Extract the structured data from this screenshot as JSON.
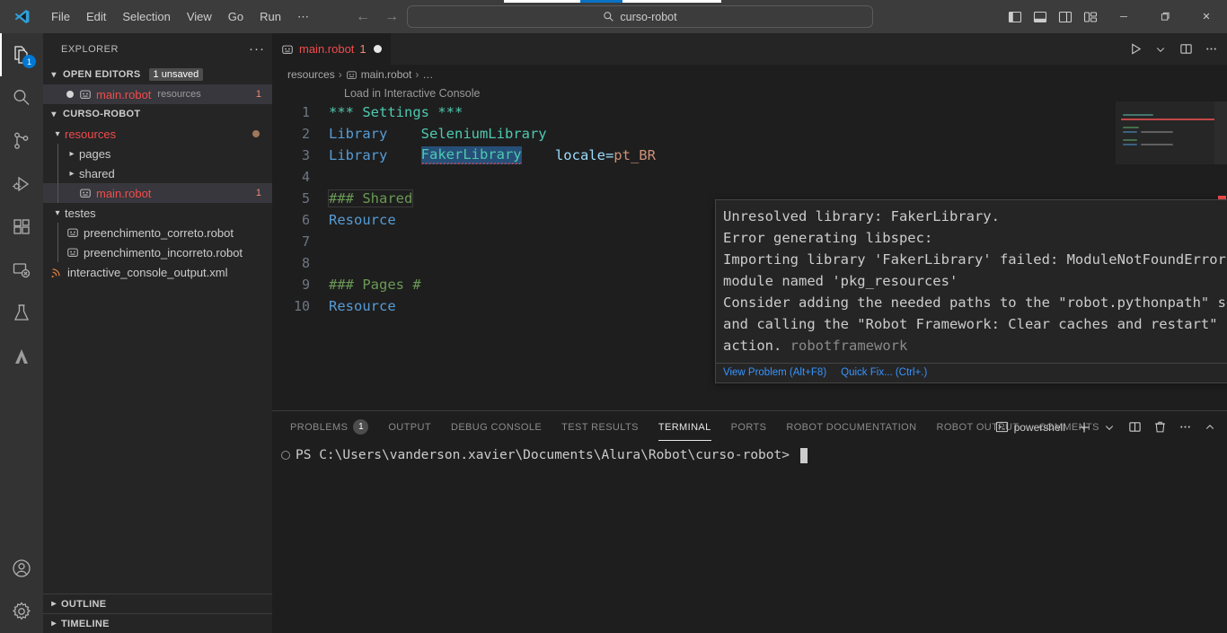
{
  "window": {
    "title": "main.robot",
    "menu": [
      "File",
      "Edit",
      "Selection",
      "View",
      "Go",
      "Run",
      "⋯"
    ],
    "search_value": "curso-robot",
    "nav_back": "←",
    "nav_forward": "→",
    "minimize": "─",
    "maximize": "❐",
    "close": "✕"
  },
  "activitybar": {
    "items": [
      {
        "name": "explorer",
        "badge": "1"
      },
      {
        "name": "search",
        "badge": ""
      },
      {
        "name": "source-control",
        "badge": ""
      },
      {
        "name": "run-and-debug",
        "badge": ""
      },
      {
        "name": "extensions",
        "badge": ""
      },
      {
        "name": "remote-explorer",
        "badge": ""
      },
      {
        "name": "testing",
        "badge": ""
      },
      {
        "name": "robot-framework",
        "badge": ""
      }
    ],
    "accounts": "accounts-icon",
    "settings": "gear-icon"
  },
  "sidebar": {
    "title": "EXPLORER",
    "more": "···",
    "open_editors": {
      "label": "OPEN EDITORS",
      "badge": "1 unsaved",
      "items": [
        {
          "name": "main.robot",
          "sub": "resources",
          "errors": "1"
        }
      ]
    },
    "project": {
      "label": "CURSO-ROBOT",
      "tree": [
        {
          "label": "resources",
          "type": "folder-open",
          "depth": 1,
          "modified": true
        },
        {
          "label": "pages",
          "type": "folder",
          "depth": 2
        },
        {
          "label": "shared",
          "type": "folder",
          "depth": 2
        },
        {
          "label": "main.robot",
          "type": "robot",
          "depth": 2,
          "errors": "1",
          "selected": true
        },
        {
          "label": "testes",
          "type": "folder-open",
          "depth": 1
        },
        {
          "label": "preenchimento_correto.robot",
          "type": "robot",
          "depth": 2
        },
        {
          "label": "preenchimento_incorreto.robot",
          "type": "robot",
          "depth": 2
        },
        {
          "label": "interactive_console_output.xml",
          "type": "xml",
          "depth": 1
        }
      ]
    },
    "outline": "OUTLINE",
    "timeline": "TIMELINE"
  },
  "editor": {
    "tab": {
      "label": "main.robot",
      "error_count": "1",
      "dirty": true
    },
    "breadcrumbs": [
      "resources",
      "main.robot",
      "…"
    ],
    "codelens": "Load in Interactive Console",
    "lines": [
      {
        "n": "1",
        "tokens": [
          {
            "t": "*** Settings ***",
            "c": "tok-kw"
          }
        ]
      },
      {
        "n": "2",
        "tokens": [
          {
            "t": "Library",
            "c": "tok-set"
          },
          {
            "t": "    ",
            "c": ""
          },
          {
            "t": "SeleniumLibrary",
            "c": "tok-lib"
          }
        ]
      },
      {
        "n": "3",
        "tokens": [
          {
            "t": "Library",
            "c": "tok-set"
          },
          {
            "t": "    ",
            "c": ""
          },
          {
            "t": "FakerLibrary",
            "c": "tok-lib sel-word squiggly"
          },
          {
            "t": "    ",
            "c": ""
          },
          {
            "t": "locale=",
            "c": "tok-arg"
          },
          {
            "t": "pt_BR",
            "c": "tok-eq"
          }
        ]
      },
      {
        "n": "4",
        "tokens": []
      },
      {
        "n": "5",
        "tokens": [
          {
            "t": "### Shared",
            "c": "tok-cmt cmt-box"
          }
        ]
      },
      {
        "n": "6",
        "tokens": [
          {
            "t": "Resource",
            "c": "tok-set"
          }
        ]
      },
      {
        "n": "7",
        "tokens": []
      },
      {
        "n": "8",
        "tokens": []
      },
      {
        "n": "9",
        "tokens": [
          {
            "t": "### Pages #",
            "c": "tok-cmt"
          }
        ]
      },
      {
        "n": "10",
        "tokens": [
          {
            "t": "Resource",
            "c": "tok-set"
          }
        ]
      }
    ],
    "hover": {
      "lines": [
        "Unresolved library: FakerLibrary.",
        "Error generating libspec:",
        "Importing library 'FakerLibrary' failed: ModuleNotFoundError: No",
        "module named 'pkg_resources'",
        "Consider adding the needed paths to the \"robot.pythonpath\" setting",
        "and calling the \"Robot Framework: Clear caches and restart\""
      ],
      "last_line": "action.",
      "source": "robotframework",
      "actions": [
        "View Problem (Alt+F8)",
        "Quick Fix... (Ctrl+.)"
      ]
    },
    "actions": [
      "run-icon",
      "chevron-down-icon",
      "split-editor-icon",
      "more-actions-icon"
    ]
  },
  "panel": {
    "tabs": [
      {
        "label": "PROBLEMS",
        "count": "1",
        "active": false
      },
      {
        "label": "OUTPUT",
        "count": "",
        "active": false
      },
      {
        "label": "DEBUG CONSOLE",
        "count": "",
        "active": false
      },
      {
        "label": "TEST RESULTS",
        "count": "",
        "active": false
      },
      {
        "label": "TERMINAL",
        "count": "",
        "active": true
      },
      {
        "label": "PORTS",
        "count": "",
        "active": false
      },
      {
        "label": "ROBOT DOCUMENTATION",
        "count": "",
        "active": false
      },
      {
        "label": "ROBOT OUTPUT",
        "count": "",
        "active": false
      },
      {
        "label": "COMMENTS",
        "count": "",
        "active": false
      }
    ],
    "terminal_name": "powershell",
    "buttons": [
      "new-terminal-icon",
      "chevron-down-icon",
      "split-terminal-icon",
      "kill-terminal-icon",
      "more-actions-icon",
      "chevron-up-icon"
    ],
    "terminal_prompt": "PS C:\\Users\\vanderson.xavier\\Documents\\Alura\\Robot\\curso-robot>"
  },
  "colors": {
    "accent": "#0078d4",
    "error": "#f14c4c",
    "editor_bg": "#1e1e1e",
    "sidebar_bg": "#252526",
    "titlebar_bg": "#3c3c3c",
    "link": "#3794ff"
  }
}
